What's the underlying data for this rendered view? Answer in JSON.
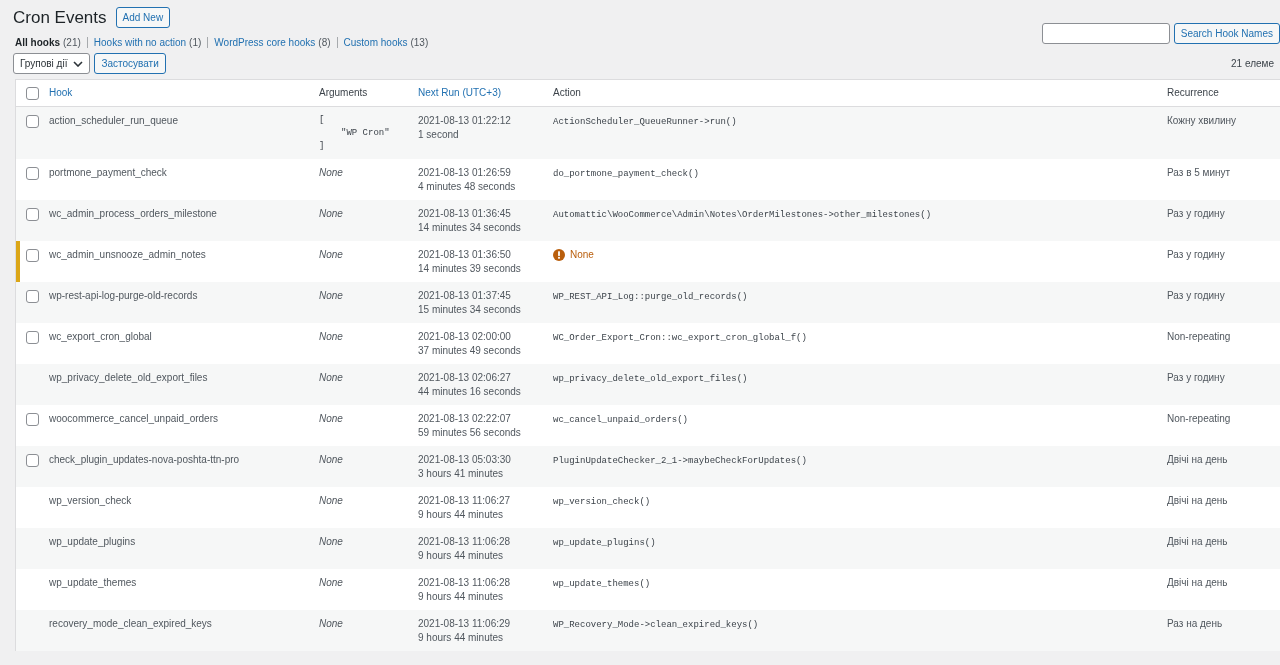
{
  "page_title": "Cron Events",
  "add_new": "Add New",
  "filters": [
    {
      "label": "All hooks",
      "count": "(21)",
      "selected": true
    },
    {
      "label": "Hooks with no action",
      "count": "(1)",
      "selected": false
    },
    {
      "label": "WordPress core hooks",
      "count": "(8)",
      "selected": false
    },
    {
      "label": "Custom hooks",
      "count": "(13)",
      "selected": false
    }
  ],
  "search": {
    "button": "Search Hook Names"
  },
  "bulk_actions": {
    "value": "Групові дії",
    "apply": "Застосувати"
  },
  "item_count": "21 елеме",
  "table": {
    "select_all": {
      "checked": false
    },
    "columns": [
      {
        "label": "Hook",
        "sortable": true
      },
      {
        "label": "Arguments",
        "sortable": false
      },
      {
        "label": "Next Run (UTC+3)",
        "sortable": true
      },
      {
        "label": "Action",
        "sortable": false
      },
      {
        "label": "Recurrence",
        "sortable": false
      }
    ],
    "rows": [
      {
        "selectable": true,
        "checked": false,
        "warning": false,
        "hook": "action_scheduler_run_queue",
        "arguments": {
          "kind": "code",
          "lines": [
            "[",
            "\"WP Cron\"",
            "]"
          ]
        },
        "next_run": "2021-08-13 01:22:12",
        "relative": "1 second",
        "action": {
          "kind": "code",
          "text": "ActionScheduler_QueueRunner->run()"
        },
        "recurrence": "Кожну хвилину"
      },
      {
        "selectable": true,
        "checked": false,
        "warning": false,
        "hook": "portmone_payment_check",
        "arguments": {
          "kind": "none",
          "text": "None"
        },
        "next_run": "2021-08-13 01:26:59",
        "relative": "4 minutes 48 seconds",
        "action": {
          "kind": "code",
          "text": "do_portmone_payment_check()"
        },
        "recurrence": "Раз в 5 минут"
      },
      {
        "selectable": true,
        "checked": false,
        "warning": false,
        "hook": "wc_admin_process_orders_milestone",
        "arguments": {
          "kind": "none",
          "text": "None"
        },
        "next_run": "2021-08-13 01:36:45",
        "relative": "14 minutes 34 seconds",
        "action": {
          "kind": "code",
          "text": "Automattic\\WooCommerce\\Admin\\Notes\\OrderMilestones->other_milestones()"
        },
        "recurrence": "Раз у годину"
      },
      {
        "selectable": true,
        "checked": false,
        "warning": true,
        "hook": "wc_admin_unsnooze_admin_notes",
        "arguments": {
          "kind": "none",
          "text": "None"
        },
        "next_run": "2021-08-13 01:36:50",
        "relative": "14 minutes 39 seconds",
        "action": {
          "kind": "missing",
          "text": "None"
        },
        "recurrence": "Раз у годину"
      },
      {
        "selectable": true,
        "checked": false,
        "warning": false,
        "hook": "wp-rest-api-log-purge-old-records",
        "arguments": {
          "kind": "none",
          "text": "None"
        },
        "next_run": "2021-08-13 01:37:45",
        "relative": "15 minutes 34 seconds",
        "action": {
          "kind": "code",
          "text": "WP_REST_API_Log::purge_old_records()"
        },
        "recurrence": "Раз у годину"
      },
      {
        "selectable": true,
        "checked": false,
        "warning": false,
        "hook": "wc_export_cron_global",
        "arguments": {
          "kind": "none",
          "text": "None"
        },
        "next_run": "2021-08-13 02:00:00",
        "relative": "37 minutes 49 seconds",
        "action": {
          "kind": "code",
          "text": "WC_Order_Export_Cron::wc_export_cron_global_f()"
        },
        "recurrence": "Non-repeating"
      },
      {
        "selectable": false,
        "warning": false,
        "hook": "wp_privacy_delete_old_export_files",
        "arguments": {
          "kind": "none",
          "text": "None"
        },
        "next_run": "2021-08-13 02:06:27",
        "relative": "44 minutes 16 seconds",
        "action": {
          "kind": "code",
          "text": "wp_privacy_delete_old_export_files()"
        },
        "recurrence": "Раз у годину"
      },
      {
        "selectable": true,
        "checked": false,
        "warning": false,
        "hook": "woocommerce_cancel_unpaid_orders",
        "arguments": {
          "kind": "none",
          "text": "None"
        },
        "next_run": "2021-08-13 02:22:07",
        "relative": "59 minutes 56 seconds",
        "action": {
          "kind": "code",
          "text": "wc_cancel_unpaid_orders()"
        },
        "recurrence": "Non-repeating"
      },
      {
        "selectable": true,
        "checked": false,
        "warning": false,
        "hook": "check_plugin_updates-nova-poshta-ttn-pro",
        "arguments": {
          "kind": "none",
          "text": "None"
        },
        "next_run": "2021-08-13 05:03:30",
        "relative": "3 hours 41 minutes",
        "action": {
          "kind": "code",
          "text": "PluginUpdateChecker_2_1->maybeCheckForUpdates()"
        },
        "recurrence": "Двічі на день"
      },
      {
        "selectable": false,
        "warning": false,
        "hook": "wp_version_check",
        "arguments": {
          "kind": "none",
          "text": "None"
        },
        "next_run": "2021-08-13 11:06:27",
        "relative": "9 hours 44 minutes",
        "action": {
          "kind": "code",
          "text": "wp_version_check()"
        },
        "recurrence": "Двічі на день"
      },
      {
        "selectable": false,
        "warning": false,
        "hook": "wp_update_plugins",
        "arguments": {
          "kind": "none",
          "text": "None"
        },
        "next_run": "2021-08-13 11:06:28",
        "relative": "9 hours 44 minutes",
        "action": {
          "kind": "code",
          "text": "wp_update_plugins()"
        },
        "recurrence": "Двічі на день"
      },
      {
        "selectable": false,
        "warning": false,
        "hook": "wp_update_themes",
        "arguments": {
          "kind": "none",
          "text": "None"
        },
        "next_run": "2021-08-13 11:06:28",
        "relative": "9 hours 44 minutes",
        "action": {
          "kind": "code",
          "text": "wp_update_themes()"
        },
        "recurrence": "Двічі на день"
      },
      {
        "selectable": false,
        "warning": false,
        "hook": "recovery_mode_clean_expired_keys",
        "arguments": {
          "kind": "none",
          "text": "None"
        },
        "next_run": "2021-08-13 11:06:29",
        "relative": "9 hours 44 minutes",
        "action": {
          "kind": "code",
          "text": "WP_Recovery_Mode->clean_expired_keys()"
        },
        "recurrence": "Раз на день"
      }
    ]
  }
}
